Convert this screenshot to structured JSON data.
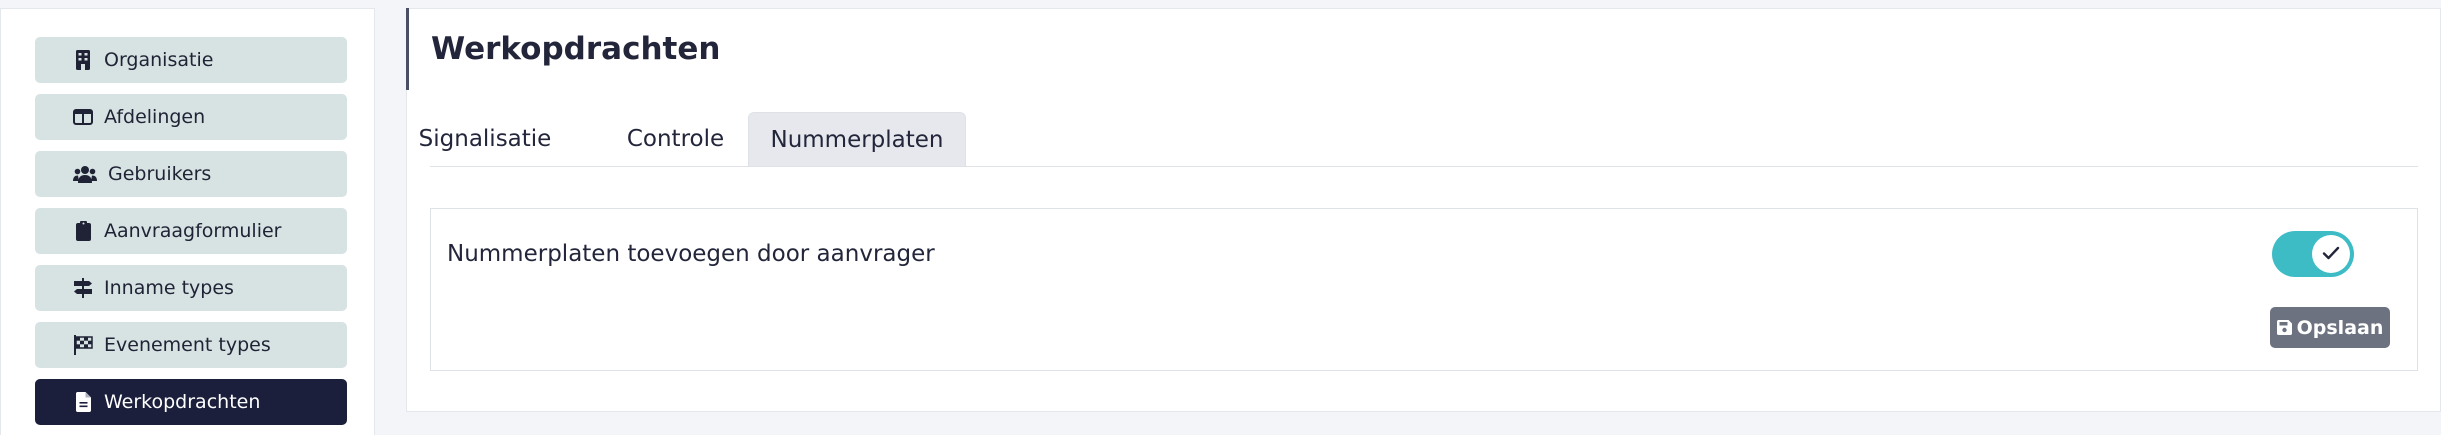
{
  "sidebar": {
    "items": [
      {
        "label": "Organisatie",
        "icon": "building-icon",
        "active": false
      },
      {
        "label": "Afdelingen",
        "icon": "table-columns-icon",
        "active": false
      },
      {
        "label": "Gebruikers",
        "icon": "users-icon",
        "active": false
      },
      {
        "label": "Aanvraagformulier",
        "icon": "clipboard-icon",
        "active": false
      },
      {
        "label": "Inname types",
        "icon": "signs-post-icon",
        "active": false
      },
      {
        "label": "Evenement types",
        "icon": "flag-checkered-icon",
        "active": false
      },
      {
        "label": "Werkopdrachten",
        "icon": "file-lines-icon",
        "active": true
      }
    ]
  },
  "main": {
    "title": "Werkopdrachten",
    "tabs": [
      {
        "label": "Signalisatie",
        "active": false
      },
      {
        "label": "Controle",
        "active": false
      },
      {
        "label": "Nummerplaten",
        "active": true
      }
    ],
    "setting": {
      "label": "Nummerplaten toevoegen door aanvrager",
      "enabled": true
    },
    "save_label": "Opslaan",
    "save_icon": "floppy-disk-icon"
  },
  "colors": {
    "sidebar_item_bg": "#d7e2e2",
    "sidebar_active_bg": "#1b1f3b",
    "toggle_on": "#3ebcc6",
    "save_button_bg": "#6c7280"
  }
}
